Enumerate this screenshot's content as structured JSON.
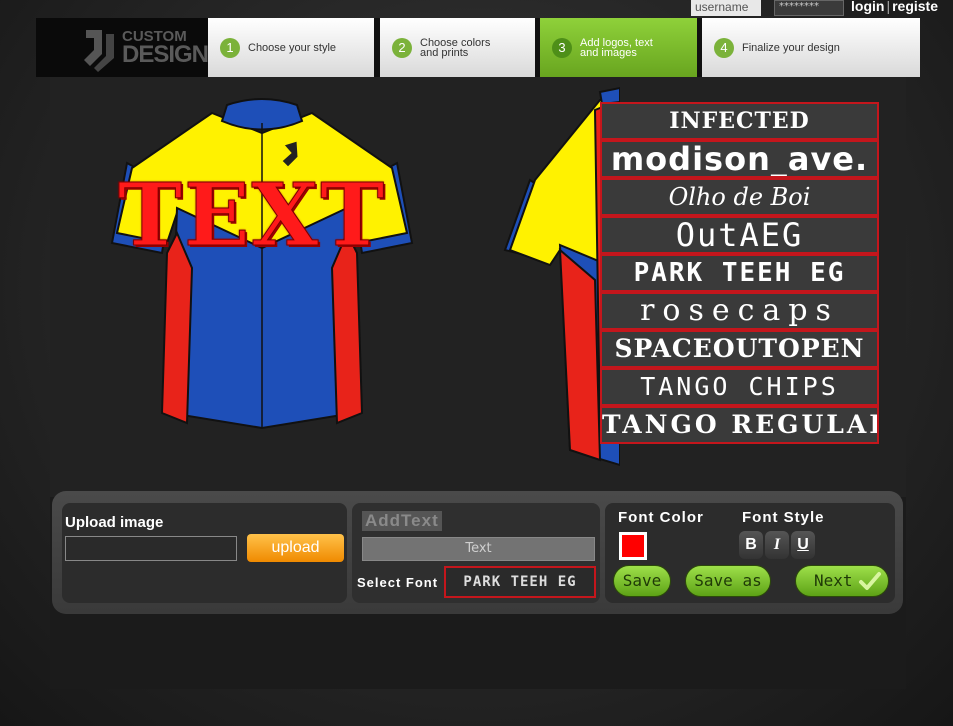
{
  "auth": {
    "username_placeholder": "username",
    "password_mask": "********",
    "login_label": "login",
    "register_label": "registe"
  },
  "brand": {
    "line1": "CUSTOM",
    "line2": "DESIGN"
  },
  "steps": [
    {
      "num": "1",
      "label": "Choose your style"
    },
    {
      "num": "2",
      "label": "Choose colors\nand prints"
    },
    {
      "num": "3",
      "label": "Add logos, text\nand images"
    },
    {
      "num": "4",
      "label": "Finalize your design"
    }
  ],
  "design": {
    "overlay_text": "TEXT"
  },
  "font_list": [
    "INFECTED",
    "modison_ave.",
    "Olho de Boi",
    "OutAEG",
    "PARK TEEH EG",
    "rosecaps",
    "SPACEOUTOPEN",
    "TANGO CHIPS",
    "TANGO REGULAR"
  ],
  "upload": {
    "title": "Upload image",
    "button": "upload"
  },
  "add_text": {
    "title": "AddText",
    "input_placeholder": "Text",
    "select_font_label": "Select Font",
    "selected_font": "PARK TEEH EG"
  },
  "font_color": {
    "title": "Font Color",
    "value": "#ff0000"
  },
  "font_style": {
    "title": "Font Style",
    "bold": "B",
    "italic": "I",
    "underline": "U"
  },
  "actions": {
    "save": "Save",
    "save_as": "Save as",
    "next": "Next"
  },
  "colors": {
    "accent_green": "#8fd13a",
    "jersey_yellow": "#fff200",
    "jersey_blue": "#1e4fb8",
    "jersey_red": "#e8231a"
  }
}
